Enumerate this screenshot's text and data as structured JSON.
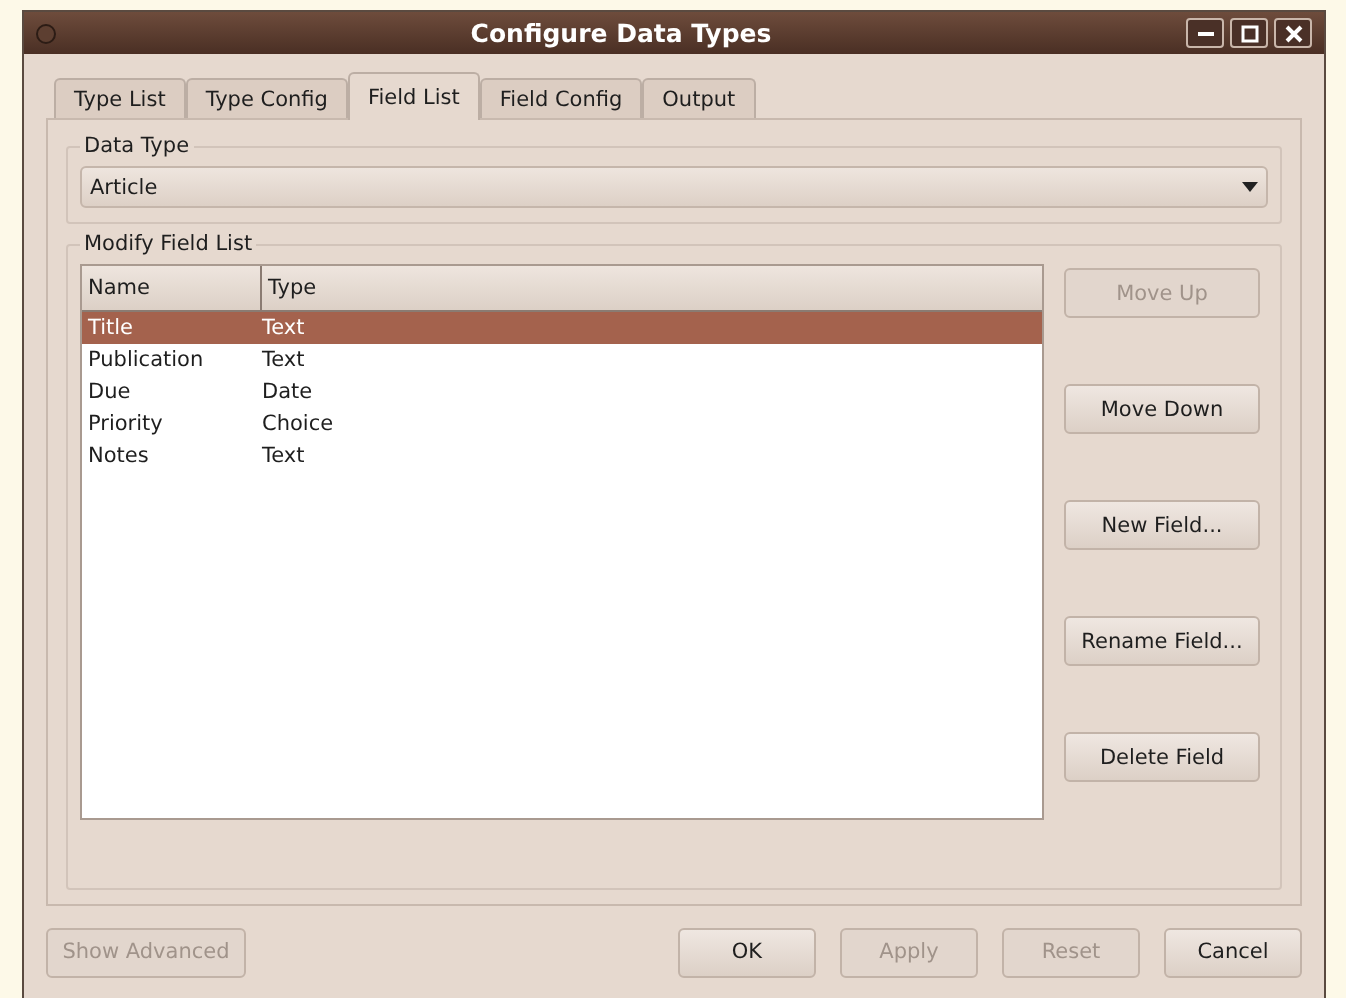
{
  "window": {
    "title": "Configure Data Types"
  },
  "tabs": [
    {
      "label": "Type List",
      "selected": false
    },
    {
      "label": "Type Config",
      "selected": false
    },
    {
      "label": "Field List",
      "selected": true
    },
    {
      "label": "Field Config",
      "selected": false
    },
    {
      "label": "Output",
      "selected": false
    }
  ],
  "data_type": {
    "label": "Data Type",
    "value": "Article"
  },
  "field_list": {
    "label": "Modify Field List",
    "columns": [
      "Name",
      "Type"
    ],
    "rows": [
      {
        "name": "Title",
        "type": "Text",
        "selected": true
      },
      {
        "name": "Publication",
        "type": "Text",
        "selected": false
      },
      {
        "name": "Due",
        "type": "Date",
        "selected": false
      },
      {
        "name": "Priority",
        "type": "Choice",
        "selected": false
      },
      {
        "name": "Notes",
        "type": "Text",
        "selected": false
      }
    ],
    "buttons": [
      {
        "label": "Move Up",
        "disabled": true
      },
      {
        "label": "Move Down",
        "disabled": false
      },
      {
        "label": "New Field...",
        "disabled": false
      },
      {
        "label": "Rename Field...",
        "disabled": false
      },
      {
        "label": "Delete Field",
        "disabled": false
      }
    ]
  },
  "footer": {
    "left": [
      {
        "label": "Show Advanced",
        "disabled": true
      }
    ],
    "right": [
      {
        "label": "OK",
        "disabled": false
      },
      {
        "label": "Apply",
        "disabled": true
      },
      {
        "label": "Reset",
        "disabled": true
      },
      {
        "label": "Cancel",
        "disabled": false
      }
    ]
  }
}
